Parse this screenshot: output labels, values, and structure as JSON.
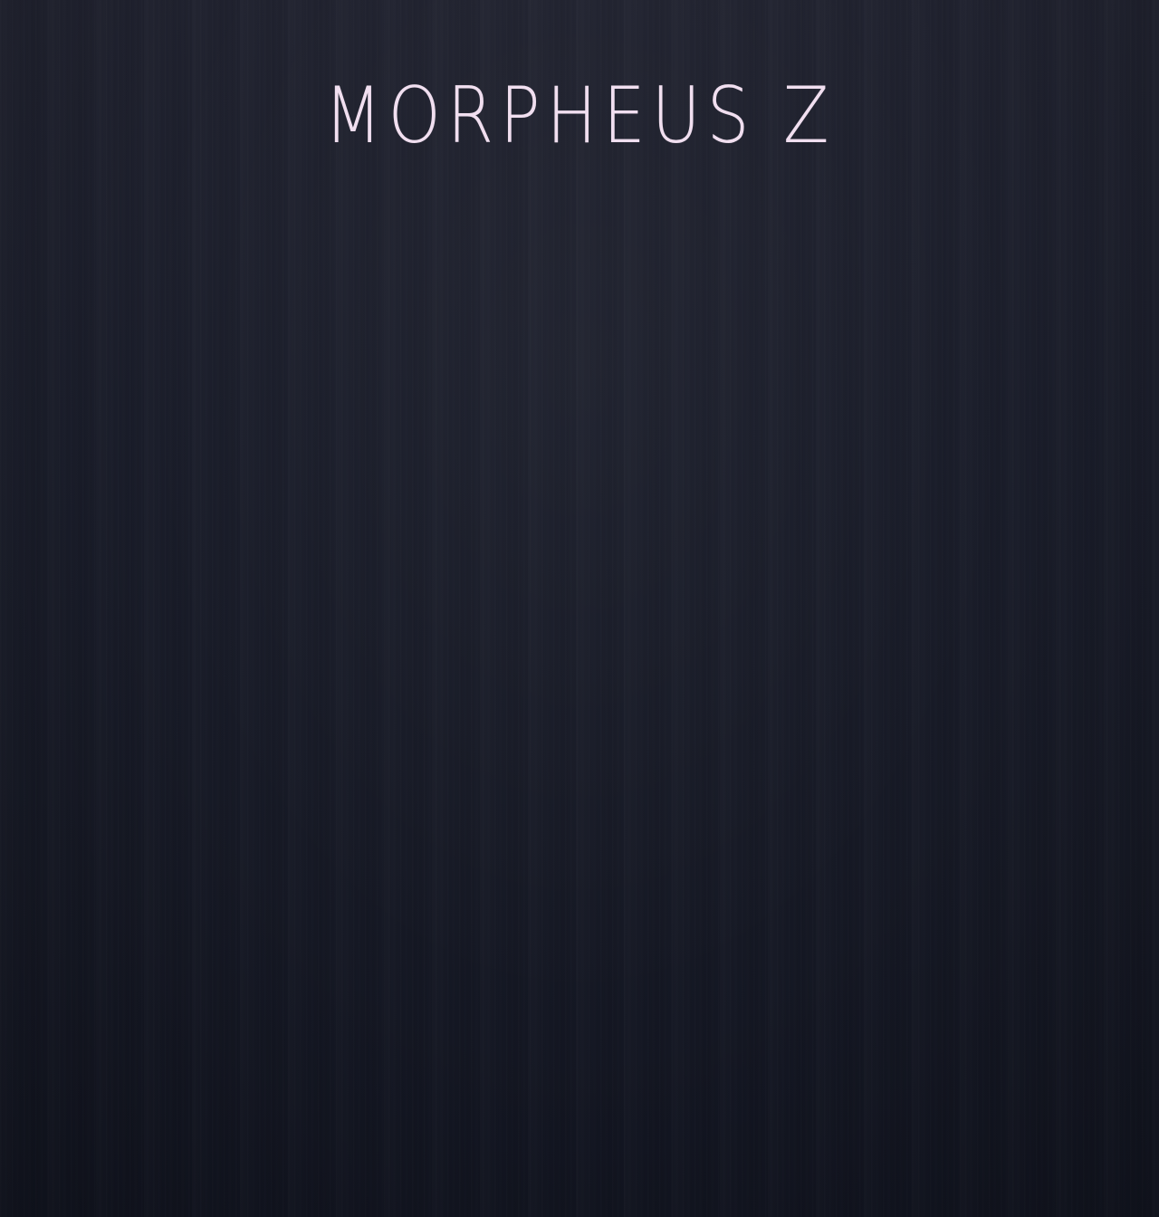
{
  "app": {
    "logo_text": "MORPHEUS Z"
  },
  "colors": {
    "background_top": "#20222f",
    "background_bottom": "#121521",
    "logo": "#f1dff0"
  }
}
